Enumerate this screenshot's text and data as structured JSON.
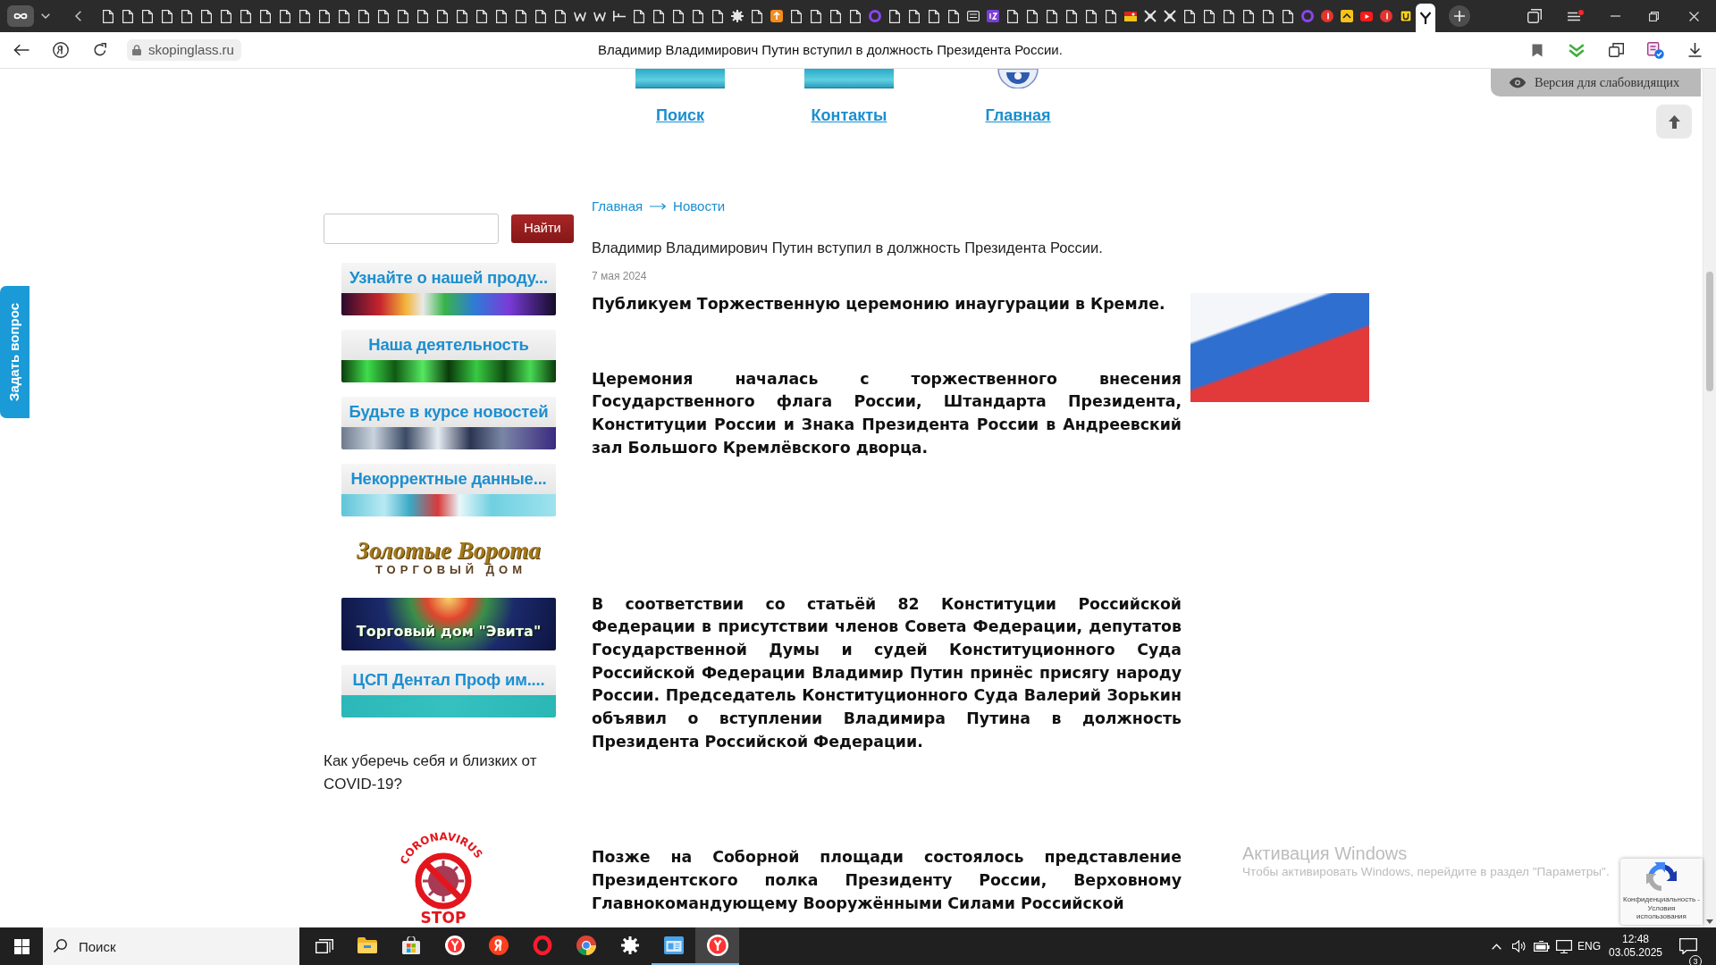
{
  "browser": {
    "tabs": [
      {
        "selected": false
      },
      {
        "selected": false
      },
      {
        "selected": false
      },
      {
        "selected": false
      },
      {
        "selected": false
      },
      {
        "selected": false
      },
      {
        "selected": false
      },
      {
        "selected": false
      },
      {
        "selected": false
      },
      {
        "selected": false
      },
      {
        "selected": false
      },
      {
        "selected": false
      },
      {
        "selected": false
      },
      {
        "selected": false
      },
      {
        "selected": false
      },
      {
        "selected": false
      },
      {
        "selected": false
      },
      {
        "selected": false
      },
      {
        "selected": false
      },
      {
        "selected": false
      },
      {
        "selected": false
      },
      {
        "selected": false
      },
      {
        "selected": false
      },
      {
        "selected": false
      },
      {
        "selected": false
      },
      {
        "selected": false
      },
      {
        "selected": false
      },
      {
        "selected": false
      },
      {
        "selected": false
      },
      {
        "selected": false
      },
      {
        "selected": false
      },
      {
        "selected": false
      },
      {
        "selected": false
      },
      {
        "selected": false
      },
      {
        "selected": false
      },
      {
        "selected": false
      },
      {
        "selected": false
      },
      {
        "selected": false
      },
      {
        "selected": false
      },
      {
        "selected": false
      },
      {
        "selected": false
      },
      {
        "selected": false
      },
      {
        "selected": false
      },
      {
        "selected": false
      },
      {
        "selected": false
      },
      {
        "selected": false
      },
      {
        "selected": false
      },
      {
        "selected": false
      },
      {
        "selected": false
      },
      {
        "selected": false
      },
      {
        "selected": false
      },
      {
        "selected": false
      },
      {
        "selected": false
      },
      {
        "selected": false
      },
      {
        "selected": false
      },
      {
        "selected": false
      },
      {
        "selected": false
      },
      {
        "selected": false
      },
      {
        "selected": false
      },
      {
        "selected": false
      },
      {
        "selected": false
      },
      {
        "selected": false
      },
      {
        "selected": false
      },
      {
        "selected": false
      },
      {
        "selected": false
      },
      {
        "selected": false
      },
      {
        "selected": false
      },
      {
        "selected": true
      }
    ],
    "url": "skopinglass.ru",
    "page_title": "Владимир Владимирович Путин вступил в должность Президента России."
  },
  "top_nav": [
    {
      "label": "Поиск"
    },
    {
      "label": "Контакты"
    },
    {
      "label": "Главная"
    }
  ],
  "accessibility_button": {
    "label": "Версия для слабовидящих"
  },
  "ask_tab": {
    "label": "Задать вопрос"
  },
  "sidebar": {
    "search_button": "Найти",
    "banners": [
      {
        "kind": "caption",
        "title": "Узнайте о нашей проду..."
      },
      {
        "kind": "caption",
        "title": "Наша деятельность"
      },
      {
        "kind": "caption",
        "title": "Будьте в курсе новостей"
      },
      {
        "kind": "caption",
        "title": "Некорректные данные..."
      },
      {
        "kind": "logo",
        "title": "Золотые Ворота",
        "subtitle": "ТОРГОВЫЙ ДОМ"
      },
      {
        "kind": "poster",
        "title": "Торговый дом \"Эвита\""
      },
      {
        "kind": "caption",
        "title": "ЦСП Дентал Проф им...."
      }
    ],
    "covid_link": "Как уберечь себя и близких от COVID-19?",
    "covid_badge": {
      "arc_text": "CORONAVIRUS",
      "label": "STOP"
    }
  },
  "breadcrumb": [
    {
      "label": "Главная"
    },
    {
      "label": "Новости"
    }
  ],
  "article": {
    "title": "Владимир Владимирович Путин вступил в должность Президента России.",
    "date": "7 мая 2024",
    "paragraphs": [
      "Публикуем Торжественную церемонию инаугурации в Кремле.",
      "Церемония началась с торжественного внесения Государственного флага России, Штандарта Президента, Конституции России и Знака Президента России в Андреевский зал Большого Кремлёвского дворца.",
      "В соответствии со статьёй 82 Конституции Российской Федерации в присутствии членов Совета Федерации, депутатов Государственной Думы и судей Конституционного Суда Российской Федерации Владимир Путин принёс присягу народу России. Председатель Конституционного Суда Валерий Зорькин объявил о вступлении Владимира Путина в должность Президента Российской Федерации.",
      "Позже на Соборной площади состоялось представление Президентского полка Президенту России, Верховному Главнокомандующему Вооружёнными Силами Российской"
    ]
  },
  "windows_activation": {
    "title": "Активация Windows",
    "text": "Чтобы активировать Windows, перейдите в раздел \"Параметры\"."
  },
  "recaptcha": {
    "text": "Конфиденциальность - Условия использования"
  },
  "taskbar": {
    "search": {
      "placeholder": "Поиск"
    },
    "apps": [
      {
        "running": false,
        "selected": false
      },
      {
        "running": false,
        "selected": false
      },
      {
        "running": false,
        "selected": false
      },
      {
        "running": false,
        "selected": false
      },
      {
        "running": false,
        "selected": false
      },
      {
        "running": false,
        "selected": false
      },
      {
        "running": false,
        "selected": false
      },
      {
        "running": true,
        "selected": false
      },
      {
        "running": true,
        "selected": true
      }
    ],
    "language": "ENG",
    "time": "12:48",
    "date": "03.05.2025",
    "notifications": "3"
  }
}
